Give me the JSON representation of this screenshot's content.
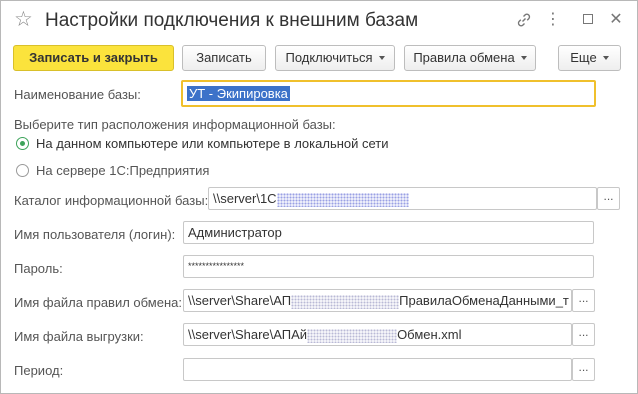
{
  "window": {
    "title": "Настройки подключения к внешним базам"
  },
  "toolbar": {
    "save_close_label": "Записать и закрыть",
    "save_label": "Записать",
    "connect_label": "Подключиться",
    "exchange_rules_label": "Правила обмена",
    "more_label": "Еще"
  },
  "form": {
    "base_name_label": "Наименование базы:",
    "base_name_value": "УТ - Экипировка",
    "location_question": "Выберите тип расположения информационной базы:",
    "radio_local_label": "На данном компьютере или компьютере в локальной сети",
    "radio_server_label": "На сервере 1С:Предприятия",
    "catalog_label": "Каталог информационной базы:",
    "catalog_value_prefix": "\\\\server\\1С",
    "username_label": "Имя пользователя (логин):",
    "username_value": "Администратор",
    "password_label": "Пароль:",
    "password_value": "****************",
    "rules_file_label": "Имя файла правил обмена:",
    "rules_file_prefix": "\\\\server\\Share\\АП",
    "rules_file_suffix": "ПравилаОбменаДанными_т",
    "export_file_label": "Имя файла выгрузки:",
    "export_file_prefix": "\\\\server\\Share\\АПАй",
    "export_file_suffix": "Обмен.xml",
    "period_label": "Период:",
    "period_value": "",
    "ellipsis": "..."
  },
  "colors": {
    "primary_button": "#fbe33c",
    "focus_border": "#f0c02c",
    "selection": "#3c72c9",
    "radio_checked": "#3da35a"
  },
  "icons": {
    "favorite": "star-icon",
    "link": "link-icon",
    "more": "more-vertical-icon",
    "maximize": "maximize-icon",
    "close": "close-icon"
  }
}
